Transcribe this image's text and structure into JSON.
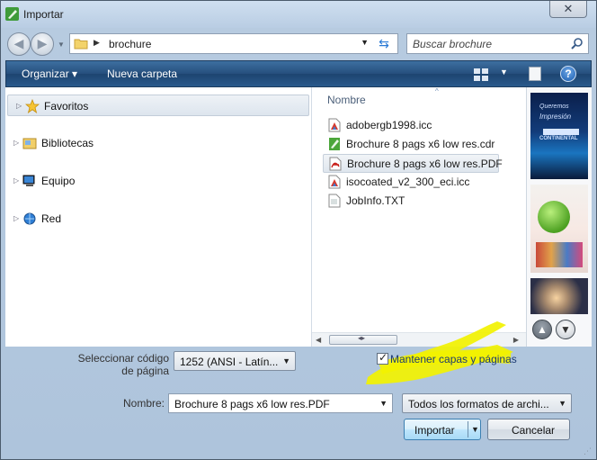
{
  "window": {
    "title": "Importar",
    "close_glyph": "✕"
  },
  "navigation": {
    "back_glyph": "◀",
    "forward_glyph": "▶",
    "address": {
      "current_folder": "brochure"
    },
    "search": {
      "placeholder": "Buscar brochure"
    }
  },
  "command_bar": {
    "organize_label": "Organizar ▾",
    "new_folder_label": "Nueva carpeta",
    "help_label": "?"
  },
  "nav_pane": {
    "items": [
      {
        "label": "Favoritos",
        "icon": "star-icon",
        "selected": true
      },
      {
        "label": "Bibliotecas",
        "icon": "libraries-icon",
        "selected": false
      },
      {
        "label": "Equipo",
        "icon": "computer-icon",
        "selected": false
      },
      {
        "label": "Red",
        "icon": "network-icon",
        "selected": false
      }
    ]
  },
  "file_list": {
    "column_header": "Nombre",
    "files": [
      {
        "name": "adobergb1998.icc",
        "icon": "color-profile-icon",
        "selected": false
      },
      {
        "name": "Brochure 8 pags x6 low res.cdr",
        "icon": "coreldraw-file-icon",
        "selected": false
      },
      {
        "name": "Brochure 8 pags x6 low res.PDF",
        "icon": "pdf-file-icon",
        "selected": true
      },
      {
        "name": "isocoated_v2_300_eci.icc",
        "icon": "color-profile-icon",
        "selected": false
      },
      {
        "name": "JobInfo.TXT",
        "icon": "text-file-icon",
        "selected": false
      }
    ]
  },
  "preview": {
    "thumb1_line1": "Queremos",
    "thumb1_line2": "Impresión",
    "thumb1_brand": "CONTINENTAL",
    "up_glyph": "▲",
    "down_glyph": "▼"
  },
  "options": {
    "code_page_label": "Seleccionar código de página",
    "code_page_value": "1252  (ANSI - Latín...",
    "keep_layers_label": "Mantener capas y páginas",
    "keep_layers_checked": true,
    "highlight_color": "#f2f200"
  },
  "filename": {
    "label": "Nombre:",
    "value": "Brochure 8 pags x6 low res.PDF",
    "filter_value": "Todos los formatos de archi..."
  },
  "buttons": {
    "import_label": "Importar",
    "cancel_label": "Cancelar"
  },
  "colors": {
    "command_bar": "#264f7d",
    "selection": "#dfe6ee"
  }
}
